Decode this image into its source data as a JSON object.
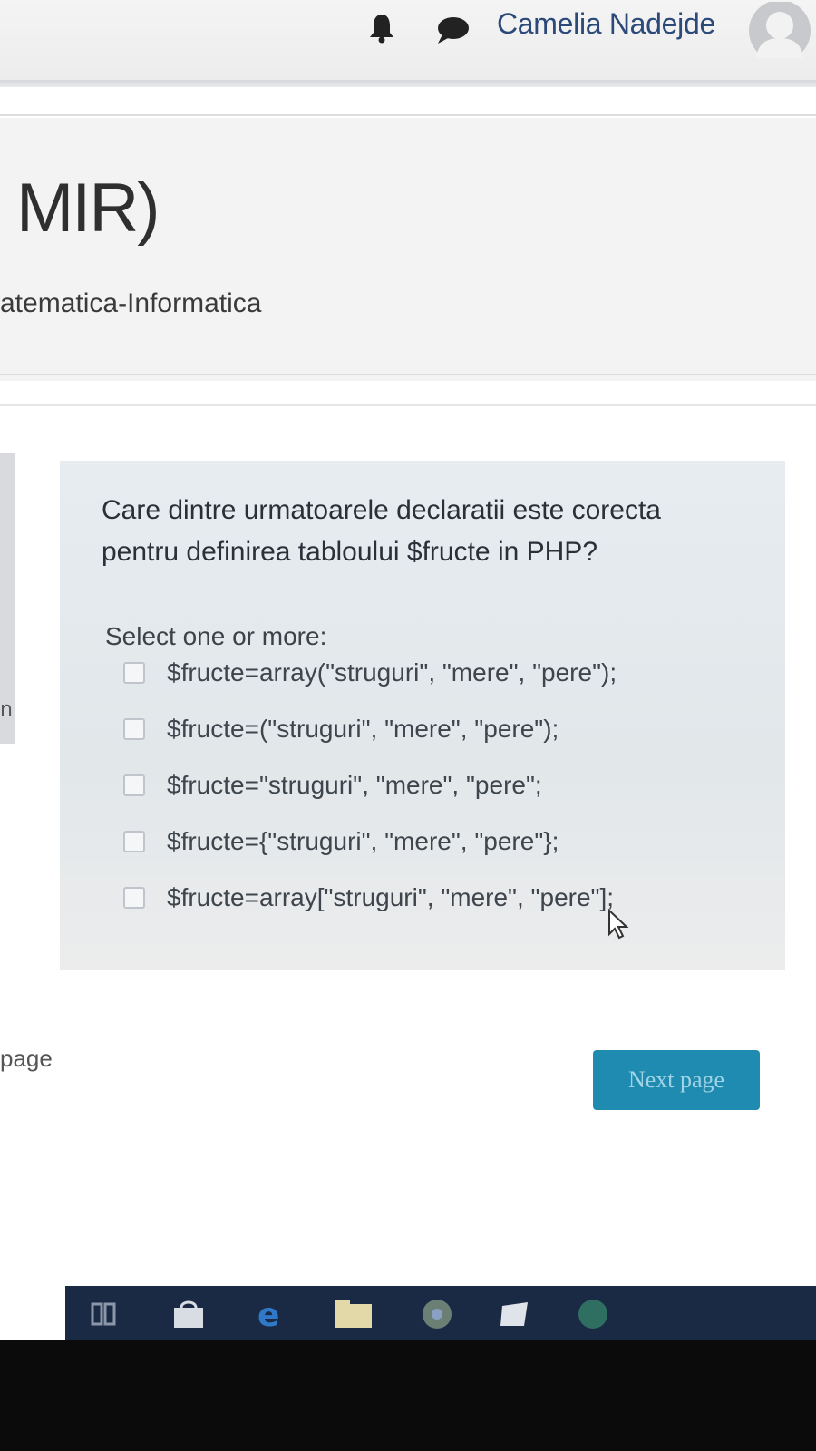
{
  "header": {
    "user_name": "Camelia Nadejde",
    "icons": [
      "bell-icon",
      "chat-icon",
      "avatar-icon"
    ]
  },
  "course": {
    "title": "MIR)",
    "subtitle": "atematica-Informatica"
  },
  "sidebar": {
    "cut_text": "n"
  },
  "question": {
    "text": "Care dintre urmatoarele declaratii este corecta pentru definirea tabloului $fructe in PHP?",
    "prompt": "Select one or more:",
    "options": [
      "$fructe=array(\"struguri\", \"mere\", \"pere\");",
      "$fructe=(\"struguri\", \"mere\", \"pere\");",
      "$fructe=\"struguri\", \"mere\", \"pere\";",
      "$fructe={\"struguri\", \"mere\", \"pere\"};",
      "$fructe=array[\"struguri\", \"mere\", \"pere\"];"
    ]
  },
  "navigation": {
    "previous_label": "page",
    "next_label": "Next page"
  },
  "colors": {
    "username": "#2b4a7a",
    "next_button": "#1f8bb0",
    "taskbar": "#1b2a44"
  }
}
